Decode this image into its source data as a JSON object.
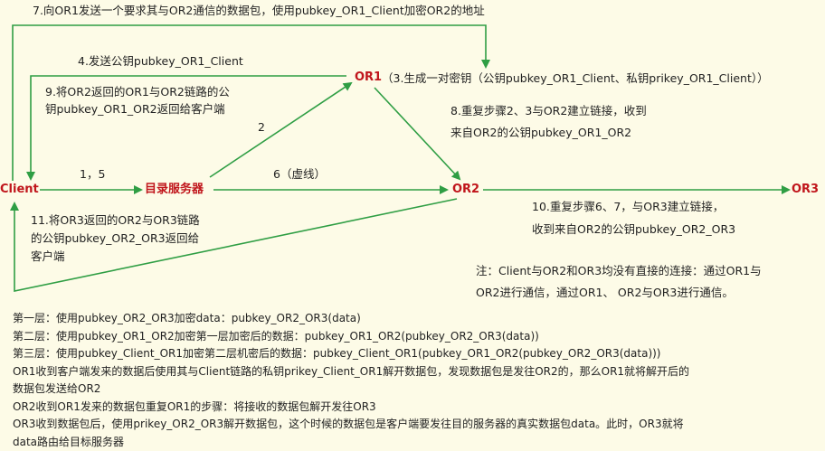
{
  "nodes": {
    "client": "Client",
    "directory": "目录服务器",
    "or1": "OR1",
    "or2": "OR2",
    "or3": "OR3"
  },
  "labels": {
    "step7": "7.向OR1发送一个要求其与OR2通信的数据包，使用pubkey_OR1_Client加密OR2的地址",
    "step4": "4.发送公钥pubkey_OR1_Client",
    "step3": "（3.生成一对密钥（公钥pubkey_OR1_Client、私钥prikey_OR1_Client））",
    "step9_line1": "9.将OR2返回的OR1与OR2链路的公",
    "step9_line2": "钥pubkey_OR1_OR2返回给客户端",
    "step2": "2",
    "step8_line1": "8.重复步骤2、3与OR2建立链接，收到",
    "step8_line2": "来自OR2的公钥pubkey_OR1_OR2",
    "step15": "1，5",
    "step6": "6（虚线）",
    "step11_line1": "11.将OR3返回的OR2与OR3链路",
    "step11_line2": "的公钥pubkey_OR2_OR3返回给",
    "step11_line3": "客户端",
    "step10_line1": "10.重复步骤6、7，与OR3建立链接，",
    "step10_line2": "收到来自OR2的公钥pubkey_OR2_OR3",
    "note": "注：Client与OR2和OR3均没有直接的连接：通过OR1与OR2进行通信，通过OR1、 OR2与OR3进行通信。"
  },
  "layers": [
    "第一层：使用pubkey_OR2_OR3加密data：pubkey_OR2_OR3(data)",
    "第二层：使用pubkey_OR1_OR2加密第一层加密后的数据：pubkey_OR1_OR2(pubkey_OR2_OR3(data))",
    "第三层：使用pubkey_Client_OR1加密第二层机密后的数据：pubkey_Client_OR1(pubkey_OR1_OR2(pubkey_OR2_OR3(data)))",
    "OR1收到客户端发来的数据后使用其与Client链路的私钥prikey_Client_OR1解开数据包，发现数据包是发往OR2的，那么OR1就将解开后的",
    "数据包发送给OR2",
    "OR2收到OR1发来的数据包重复OR1的步骤：将接收的数据包解开发往OR3",
    "OR3收到数据包后，使用prikey_OR2_OR3解开数据包，这个时候的数据包是客户端要发往目的服务器的真实数据包data。此时，OR3就将",
    "data路由给目标服务器"
  ],
  "colors": {
    "arrow": "#2f9e44",
    "node": "#c0151b",
    "background": "#fdfbe7"
  }
}
